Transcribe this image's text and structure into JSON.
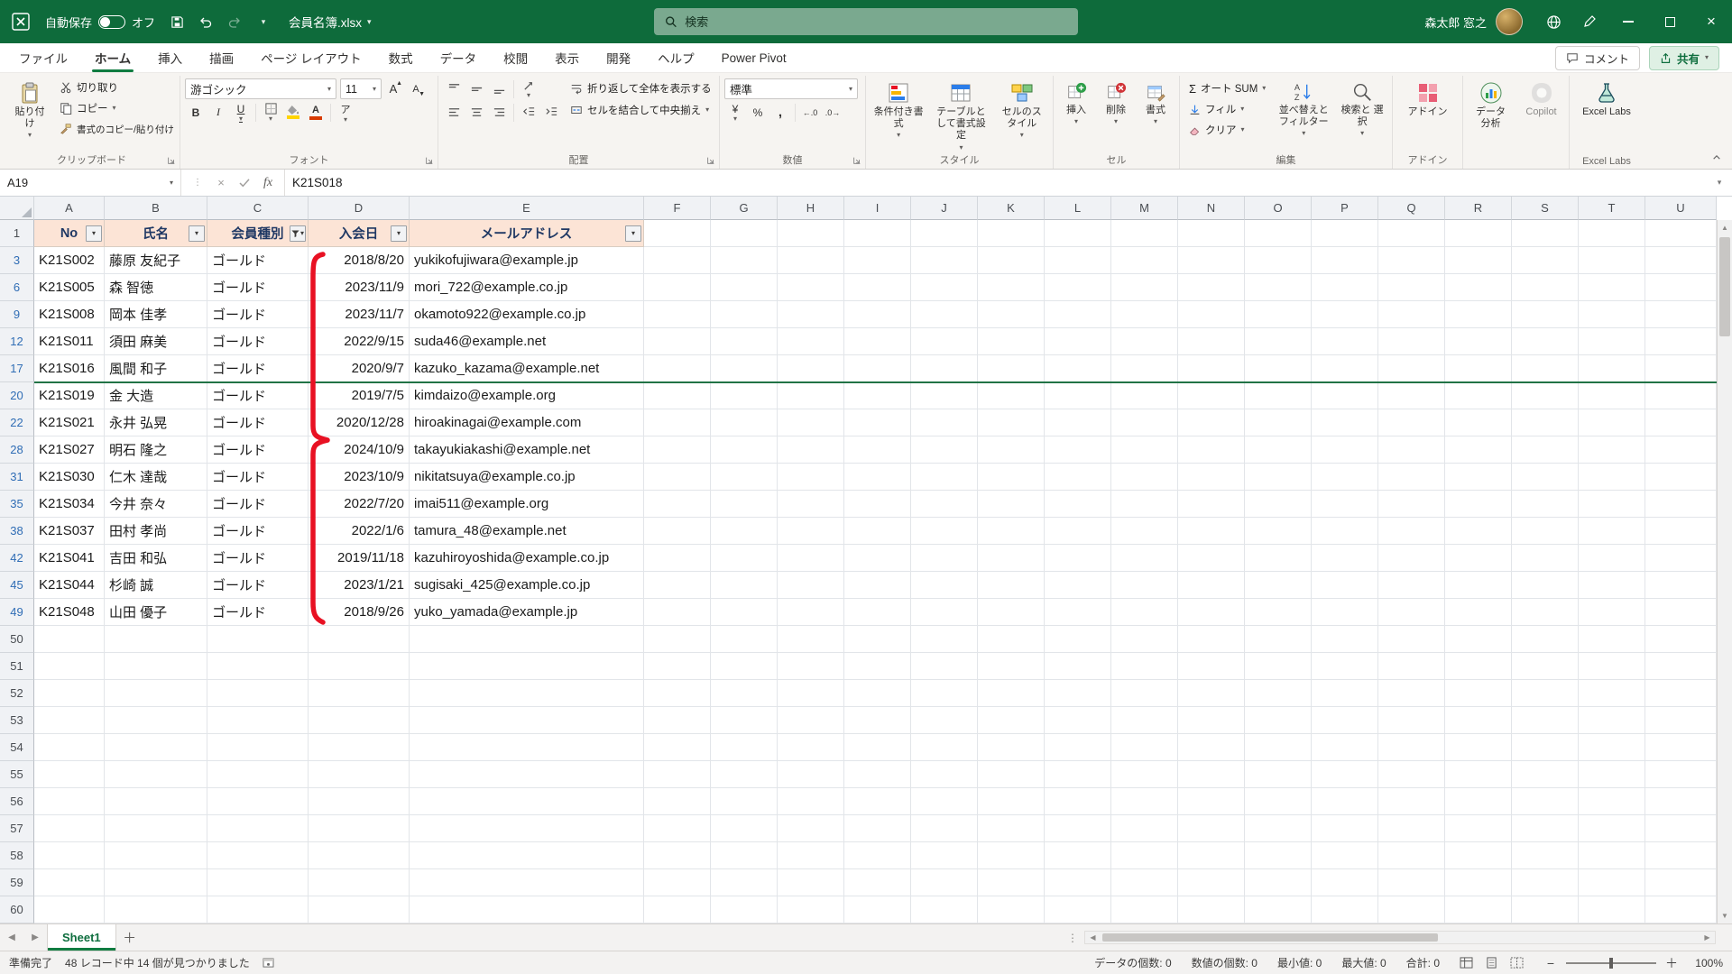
{
  "titlebar": {
    "autosave_label": "自動保存",
    "autosave_state": "オフ",
    "filename": "会員名簿.xlsx",
    "search_placeholder": "検索",
    "user_name": "森太郎 窓之"
  },
  "ribbon_tabs": [
    "ファイル",
    "ホーム",
    "挿入",
    "描画",
    "ページ レイアウト",
    "数式",
    "データ",
    "校閲",
    "表示",
    "開発",
    "ヘルプ",
    "Power Pivot"
  ],
  "active_tab": "ホーム",
  "tab_actions": {
    "comments": "コメント",
    "share": "共有"
  },
  "ribbon": {
    "clipboard": {
      "group": "クリップボード",
      "paste": "貼り付け",
      "cut": "切り取り",
      "copy": "コピー",
      "format_painter": "書式のコピー/貼り付け"
    },
    "font": {
      "group": "フォント",
      "font_name": "游ゴシック",
      "font_size": "11"
    },
    "alignment": {
      "group": "配置",
      "wrap": "折り返して全体を表示する",
      "merge": "セルを結合して中央揃え"
    },
    "number": {
      "group": "数値",
      "format": "標準"
    },
    "styles": {
      "group": "スタイル",
      "conditional": "条件付き書式",
      "format_table": "テーブルとして書式設定",
      "cell_styles": "セルのスタイル"
    },
    "cells": {
      "group": "セル",
      "insert": "挿入",
      "delete": "削除",
      "format": "書式"
    },
    "editing": {
      "group": "編集",
      "autosum": "オート SUM",
      "fill": "フィル",
      "clear": "クリア",
      "sort": "並べ替えと フィルター",
      "find": "検索と 選択"
    },
    "addins": {
      "group": "アドイン",
      "addins": "アドイン",
      "data_analysis": "データ 分析",
      "copilot": "Copilot"
    },
    "labs": {
      "group": "Excel Labs",
      "labs": "Excel Labs"
    }
  },
  "formula_bar": {
    "name_box": "A19",
    "value": "K21S018"
  },
  "grid": {
    "column_letters": [
      "A",
      "B",
      "C",
      "D",
      "E",
      "F",
      "G",
      "H",
      "I",
      "J",
      "K",
      "L",
      "M",
      "N",
      "O",
      "P",
      "Q",
      "R",
      "S",
      "T",
      "U"
    ],
    "header_row": {
      "num": "1",
      "cells": [
        {
          "label": "No",
          "filtered": false
        },
        {
          "label": "氏名",
          "filtered": false
        },
        {
          "label": "会員種別",
          "filtered": true
        },
        {
          "label": "入会日",
          "filtered": false
        },
        {
          "label": "メールアドレス",
          "filtered": false
        }
      ]
    },
    "rows": [
      {
        "num": "3",
        "no": "K21S002",
        "name": "藤原 友紀子",
        "type": "ゴールド",
        "date": "2018/8/20",
        "email": "yukikofujiwara@example.jp"
      },
      {
        "num": "6",
        "no": "K21S005",
        "name": "森 智徳",
        "type": "ゴールド",
        "date": "2023/11/9",
        "email": "mori_722@example.co.jp"
      },
      {
        "num": "9",
        "no": "K21S008",
        "name": "岡本 佳孝",
        "type": "ゴールド",
        "date": "2023/11/7",
        "email": "okamoto922@example.co.jp"
      },
      {
        "num": "12",
        "no": "K21S011",
        "name": "須田 麻美",
        "type": "ゴールド",
        "date": "2022/9/15",
        "email": "suda46@example.net"
      },
      {
        "num": "17",
        "no": "K21S016",
        "name": "風間 和子",
        "type": "ゴールド",
        "date": "2020/9/7",
        "email": "kazuko_kazama@example.net"
      },
      {
        "num": "20",
        "no": "K21S019",
        "name": "金 大造",
        "type": "ゴールド",
        "date": "2019/7/5",
        "email": "kimdaizo@example.org"
      },
      {
        "num": "22",
        "no": "K21S021",
        "name": "永井 弘晃",
        "type": "ゴールド",
        "date": "2020/12/28",
        "email": "hiroakinagai@example.com"
      },
      {
        "num": "28",
        "no": "K21S027",
        "name": "明石 隆之",
        "type": "ゴールド",
        "date": "2024/10/9",
        "email": "takayukiakashi@example.net"
      },
      {
        "num": "31",
        "no": "K21S030",
        "name": "仁木 達哉",
        "type": "ゴールド",
        "date": "2023/10/9",
        "email": "nikitatsuya@example.co.jp"
      },
      {
        "num": "35",
        "no": "K21S034",
        "name": "今井 奈々",
        "type": "ゴールド",
        "date": "2022/7/20",
        "email": "imai511@example.org"
      },
      {
        "num": "38",
        "no": "K21S037",
        "name": "田村 孝尚",
        "type": "ゴールド",
        "date": "2022/1/6",
        "email": "tamura_48@example.net"
      },
      {
        "num": "42",
        "no": "K21S041",
        "name": "吉田 和弘",
        "type": "ゴールド",
        "date": "2019/11/18",
        "email": "kazuhiroyoshida@example.co.jp"
      },
      {
        "num": "45",
        "no": "K21S044",
        "name": "杉崎 誠",
        "type": "ゴールド",
        "date": "2023/1/21",
        "email": "sugisaki_425@example.co.jp"
      },
      {
        "num": "49",
        "no": "K21S048",
        "name": "山田 優子",
        "type": "ゴールド",
        "date": "2018/9/26",
        "email": "yuko_yamada@example.jp"
      }
    ],
    "empty_rows": [
      "50",
      "51",
      "52",
      "53",
      "54",
      "55",
      "56",
      "57",
      "58",
      "59",
      "60"
    ]
  },
  "annotations": {
    "red_brace_rows": "3-49",
    "hidden_selection_row": "19"
  },
  "sheet_bar": {
    "active_tab": "Sheet1"
  },
  "status_bar": {
    "ready": "準備完了",
    "filter_result": "48 レコード中 14 個が見つかりました",
    "stats": [
      "データの個数: 0",
      "数値の個数: 0",
      "最小値: 0",
      "最大値: 0",
      "合計: 0"
    ],
    "zoom": "100%"
  },
  "colors": {
    "title_green": "#0e6b3b",
    "accent_green": "#107C41",
    "header_fill": "#fce4d6",
    "filtered_row_number": "#2f6db5",
    "annotation_red": "#e81123",
    "selection_line_green": "#217346"
  }
}
